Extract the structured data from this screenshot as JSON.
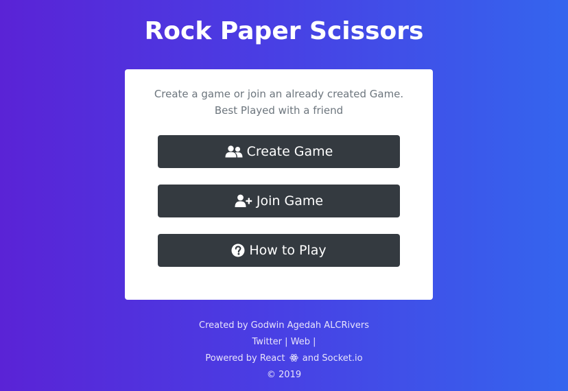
{
  "header": {
    "title": "Rock Paper Scissors"
  },
  "card": {
    "intro": "Create a game or join an already created Game. Best Played with a friend",
    "buttons": [
      {
        "label": "Create Game",
        "icon": "users-icon"
      },
      {
        "label": "Join Game",
        "icon": "user-plus-icon"
      },
      {
        "label": "How to Play",
        "icon": "question-circle-icon"
      }
    ]
  },
  "footer": {
    "created_by": "Created by Godwin Agedah ALCRivers",
    "twitter": "Twitter",
    "web": "Web",
    "separator": "|",
    "powered_prefix": "Powered by React",
    "powered_suffix": "and Socket.io",
    "copyright": "© 2019"
  },
  "colors": {
    "gradient_start": "#5a23d6",
    "gradient_end": "#3465ee",
    "button_bg": "#343a40",
    "card_bg": "#ffffff",
    "muted_text": "#6c757d"
  }
}
